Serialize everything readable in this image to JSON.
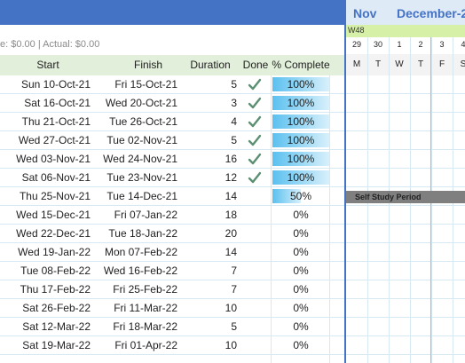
{
  "summary": {
    "cost_text": "e: $0.00 | Actual: $0.00"
  },
  "columns": {
    "start": "Start",
    "finish": "Finish",
    "duration": "Duration",
    "done": "Done",
    "percent": "% Complete"
  },
  "rows": [
    {
      "start": "Sun 10-Oct-21",
      "finish": "Fri 15-Oct-21",
      "duration": "5",
      "done": true,
      "percent": "100%",
      "progress": 1.0
    },
    {
      "start": "Sat 16-Oct-21",
      "finish": "Wed 20-Oct-21",
      "duration": "3",
      "done": true,
      "percent": "100%",
      "progress": 1.0
    },
    {
      "start": "Thu 21-Oct-21",
      "finish": "Tue 26-Oct-21",
      "duration": "4",
      "done": true,
      "percent": "100%",
      "progress": 1.0
    },
    {
      "start": "Wed 27-Oct-21",
      "finish": "Tue 02-Nov-21",
      "duration": "5",
      "done": true,
      "percent": "100%",
      "progress": 1.0
    },
    {
      "start": "Wed 03-Nov-21",
      "finish": "Wed 24-Nov-21",
      "duration": "16",
      "done": true,
      "percent": "100%",
      "progress": 1.0
    },
    {
      "start": "Sat 06-Nov-21",
      "finish": "Tue 23-Nov-21",
      "duration": "12",
      "done": true,
      "percent": "100%",
      "progress": 1.0
    },
    {
      "start": "Thu 25-Nov-21",
      "finish": "Tue 14-Dec-21",
      "duration": "14",
      "done": false,
      "percent": "50%",
      "progress": 0.5
    },
    {
      "start": "Wed 15-Dec-21",
      "finish": "Fri 07-Jan-22",
      "duration": "18",
      "done": false,
      "percent": "0%",
      "progress": 0
    },
    {
      "start": "Wed 22-Dec-21",
      "finish": "Tue 18-Jan-22",
      "duration": "20",
      "done": false,
      "percent": "0%",
      "progress": 0
    },
    {
      "start": "Wed 19-Jan-22",
      "finish": "Mon 07-Feb-22",
      "duration": "14",
      "done": false,
      "percent": "0%",
      "progress": 0
    },
    {
      "start": "Tue 08-Feb-22",
      "finish": "Wed 16-Feb-22",
      "duration": "7",
      "done": false,
      "percent": "0%",
      "progress": 0
    },
    {
      "start": "Thu 17-Feb-22",
      "finish": "Fri 25-Feb-22",
      "duration": "7",
      "done": false,
      "percent": "0%",
      "progress": 0
    },
    {
      "start": "Sat 26-Feb-22",
      "finish": "Fri 11-Mar-22",
      "duration": "10",
      "done": false,
      "percent": "0%",
      "progress": 0
    },
    {
      "start": "Sat 12-Mar-22",
      "finish": "Fri 18-Mar-22",
      "duration": "5",
      "done": false,
      "percent": "0%",
      "progress": 0
    },
    {
      "start": "Sat 19-Mar-22",
      "finish": "Fri 01-Apr-22",
      "duration": "10",
      "done": false,
      "percent": "0%",
      "progress": 0
    }
  ],
  "gantt": {
    "months": [
      "Nov",
      "December-2"
    ],
    "week": "W48",
    "days": [
      "29",
      "30",
      "1",
      "2",
      "3",
      "4"
    ],
    "weekdays": [
      "M",
      "T",
      "W",
      "T",
      "F",
      "S"
    ],
    "task_label": "Self Study Period"
  },
  "colors": {
    "header_blue": "#4472c4",
    "header_green": "#e2efda",
    "progress_blue": "#5bc0ef",
    "check_green": "#5b8f72",
    "task_gray": "#7f7f7f"
  }
}
